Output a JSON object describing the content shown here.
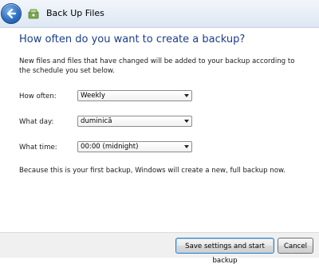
{
  "window": {
    "title": "Back Up Files"
  },
  "main": {
    "heading": "How often do you want to create a backup?",
    "description": "New files and files that have changed will be added to your backup according to the schedule you set below.",
    "fields": [
      {
        "label": "How often:",
        "value": "Weekly"
      },
      {
        "label": "What day:",
        "value": "duminică"
      },
      {
        "label": "What time:",
        "value": "00:00 (midnight)"
      }
    ],
    "note": "Because this is your first backup, Windows will create a new, full backup now."
  },
  "footer": {
    "save_label": "Save settings and start backup",
    "cancel_label": "Cancel"
  },
  "colors": {
    "heading": "#1c3d8c",
    "titlebar": "#dde7f2",
    "footer": "#f0f0f0"
  },
  "icons": {
    "back": "back-arrow-icon",
    "app": "backup-icon",
    "dropdown": "chevron-down-icon"
  }
}
